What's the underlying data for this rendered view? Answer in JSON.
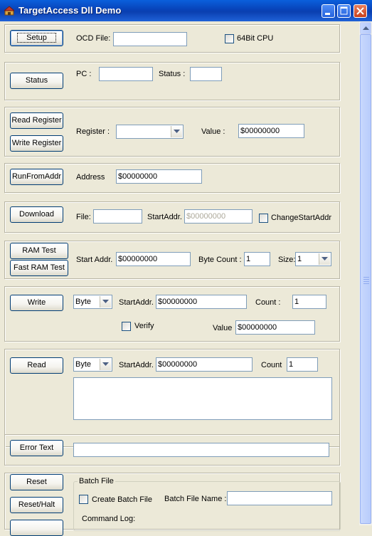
{
  "window": {
    "title": "TargetAccess Dll Demo"
  },
  "setup": {
    "button": "Setup",
    "ocd_label": "OCD File:",
    "ocd_value": "",
    "cpu64_label": "64Bit CPU"
  },
  "status": {
    "button": "Status",
    "pc_label": "PC :",
    "pc_value": "",
    "status_label": "Status :",
    "status_value": ""
  },
  "register": {
    "read_button": "Read Register",
    "write_button": "Write Register",
    "register_label": "Register :",
    "register_value": "",
    "value_label": "Value :",
    "value": "$00000000"
  },
  "run": {
    "button": "RunFromAddr",
    "address_label": "Address",
    "address_value": "$00000000"
  },
  "download": {
    "button": "Download",
    "file_label": "File:",
    "file_value": "",
    "start_label": "StartAddr.",
    "start_value": "$00000000",
    "change_label": "ChangeStartAddr"
  },
  "ram": {
    "ram_test_button": "RAM Test",
    "fast_ram_test_button": "Fast RAM Test",
    "start_label": "Start Addr.",
    "start_value": "$00000000",
    "count_label": "Byte Count :",
    "count_value": "1",
    "size_label": "Size:",
    "size_value": "1"
  },
  "write": {
    "button": "Write",
    "type_value": "Byte",
    "start_label": "StartAddr.",
    "start_value": "$00000000",
    "count_label": "Count :",
    "count_value": "1",
    "verify_label": "Verify",
    "value_label": "Value",
    "value": "$00000000"
  },
  "read": {
    "button": "Read",
    "type_value": "Byte",
    "start_label": "StartAddr.",
    "start_value": "$00000000",
    "count_label": "Count",
    "count_value": "1",
    "output": ""
  },
  "error": {
    "button": "Error Text",
    "text_value": ""
  },
  "batch": {
    "reset_button": "Reset",
    "reset_halt_button": "Reset/Halt",
    "group_label": "Batch File",
    "create_label": "Create Batch File",
    "name_label": "Batch File Name :",
    "name_value": "",
    "command_log_label": "Command Log:"
  }
}
